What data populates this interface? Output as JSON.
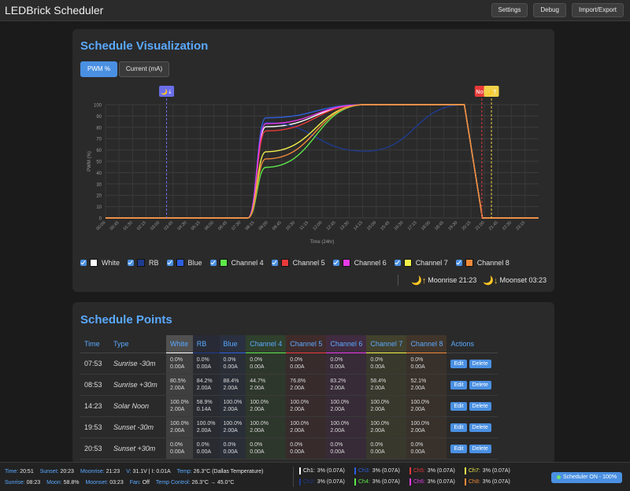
{
  "app": {
    "title": "LEDBrick Scheduler"
  },
  "top_buttons": [
    "Settings",
    "Debug",
    "Import/Export"
  ],
  "visualization": {
    "title": "Schedule Visualization",
    "toggle_pwm": "PWM %",
    "toggle_current": "Current (mA)",
    "active_toggle": "PWM %"
  },
  "chart_data": {
    "type": "line",
    "xlabel": "Time (24hr)",
    "ylabel": "PWM (%)",
    "ylim": [
      0,
      100
    ],
    "yticks": [
      0,
      10,
      20,
      30,
      40,
      50,
      60,
      70,
      80,
      90,
      100
    ],
    "xticks": [
      "00:00",
      "00:45",
      "01:30",
      "02:15",
      "03:00",
      "03:45",
      "04:30",
      "05:15",
      "06:00",
      "06:45",
      "07:30",
      "08:15",
      "09:00",
      "09:45",
      "10:30",
      "11:15",
      "12:00",
      "12:45",
      "13:30",
      "14:15",
      "15:00",
      "15:45",
      "16:30",
      "17:15",
      "18:00",
      "18:45",
      "19:30",
      "20:15",
      "21:00",
      "21:45",
      "22:30",
      "23:15"
    ],
    "grid": true,
    "series": [
      {
        "name": "White",
        "color": "#ffffff",
        "x": [
          "00:00",
          "07:53",
          "08:53",
          "14:23",
          "19:53",
          "20:53",
          "23:59"
        ],
        "values": [
          0,
          0,
          80.5,
          100,
          100,
          0,
          0
        ]
      },
      {
        "name": "RB",
        "color": "#1f3b8f",
        "x": [
          "00:00",
          "07:53",
          "08:53",
          "14:23",
          "19:53",
          "20:53",
          "23:59"
        ],
        "values": [
          0,
          0,
          84.2,
          58.9,
          100,
          0,
          0
        ]
      },
      {
        "name": "Blue",
        "color": "#2f5fe0",
        "x": [
          "00:00",
          "07:53",
          "08:53",
          "14:23",
          "19:53",
          "20:53",
          "23:59"
        ],
        "values": [
          0,
          0,
          88.4,
          100,
          100,
          0,
          0
        ]
      },
      {
        "name": "Channel 4",
        "color": "#5ee84a",
        "x": [
          "00:00",
          "07:53",
          "08:53",
          "14:23",
          "19:53",
          "20:53",
          "23:59"
        ],
        "values": [
          0,
          0,
          44.7,
          100,
          100,
          0,
          0
        ]
      },
      {
        "name": "Channel 5",
        "color": "#e83a3a",
        "x": [
          "00:00",
          "07:53",
          "08:53",
          "14:23",
          "19:53",
          "20:53",
          "23:59"
        ],
        "values": [
          0,
          0,
          76.8,
          100,
          100,
          0,
          0
        ]
      },
      {
        "name": "Channel 6",
        "color": "#e73ae8",
        "x": [
          "00:00",
          "07:53",
          "08:53",
          "14:23",
          "19:53",
          "20:53",
          "23:59"
        ],
        "values": [
          0,
          0,
          83.2,
          100,
          100,
          0,
          0
        ]
      },
      {
        "name": "Channel 7",
        "color": "#f2ef4a",
        "x": [
          "00:00",
          "07:53",
          "08:53",
          "14:23",
          "19:53",
          "20:53",
          "23:59"
        ],
        "values": [
          0,
          0,
          58.4,
          100,
          100,
          0,
          0
        ]
      },
      {
        "name": "Channel 8",
        "color": "#f08a3a",
        "x": [
          "00:00",
          "07:53",
          "08:53",
          "14:23",
          "19:53",
          "20:53",
          "23:59"
        ],
        "values": [
          0,
          0,
          52.1,
          100,
          100,
          0,
          0
        ]
      }
    ],
    "markers": [
      {
        "time": "03:23",
        "color": "#6b6ee8",
        "badge": "🌙↓"
      },
      {
        "time": "20:51",
        "color": "#e83a3a",
        "badge": "Now"
      },
      {
        "time": "21:23",
        "color": "#f2d24a",
        "badge": "🌙↑"
      }
    ]
  },
  "moon": {
    "moonrise": "Moonrise 21:23",
    "moonset": "Moonset 03:23"
  },
  "schedule": {
    "title": "Schedule Points",
    "headers": {
      "time": "Time",
      "type": "Type",
      "actions": "Actions"
    },
    "channels": [
      "White",
      "RB",
      "Blue",
      "Channel 4",
      "Channel 5",
      "Channel 6",
      "Channel 7",
      "Channel 8"
    ],
    "channel_colors": [
      "#ffffff",
      "#1f3b8f",
      "#2f5fe0",
      "#5ee84a",
      "#e83a3a",
      "#e73ae8",
      "#f2ef4a",
      "#f08a3a"
    ],
    "edit_label": "Edit",
    "delete_label": "Delete",
    "rows": [
      {
        "time": "07:53",
        "type": "Sunrise -30m",
        "values": [
          [
            "0.0%",
            "0.00A"
          ],
          [
            "0.0%",
            "0.00A"
          ],
          [
            "0.0%",
            "0.00A"
          ],
          [
            "0.0%",
            "0.00A"
          ],
          [
            "0.0%",
            "0.00A"
          ],
          [
            "0.0%",
            "0.00A"
          ],
          [
            "0.0%",
            "0.00A"
          ],
          [
            "0.0%",
            "0.00A"
          ]
        ]
      },
      {
        "time": "08:53",
        "type": "Sunrise +30m",
        "values": [
          [
            "80.5%",
            "2.00A"
          ],
          [
            "84.2%",
            "2.00A"
          ],
          [
            "88.4%",
            "2.00A"
          ],
          [
            "44.7%",
            "2.00A"
          ],
          [
            "76.8%",
            "2.00A"
          ],
          [
            "83.2%",
            "2.00A"
          ],
          [
            "58.4%",
            "2.00A"
          ],
          [
            "52.1%",
            "2.00A"
          ]
        ]
      },
      {
        "time": "14:23",
        "type": "Solar Noon",
        "values": [
          [
            "100.0%",
            "2.00A"
          ],
          [
            "58.9%",
            "0.14A"
          ],
          [
            "100.0%",
            "2.00A"
          ],
          [
            "100.0%",
            "2.00A"
          ],
          [
            "100.0%",
            "2.00A"
          ],
          [
            "100.0%",
            "2.00A"
          ],
          [
            "100.0%",
            "2.00A"
          ],
          [
            "100.0%",
            "2.00A"
          ]
        ]
      },
      {
        "time": "19:53",
        "type": "Sunset -30m",
        "values": [
          [
            "100.0%",
            "2.00A"
          ],
          [
            "100.0%",
            "2.00A"
          ],
          [
            "100.0%",
            "2.00A"
          ],
          [
            "100.0%",
            "2.00A"
          ],
          [
            "100.0%",
            "2.00A"
          ],
          [
            "100.0%",
            "2.00A"
          ],
          [
            "100.0%",
            "2.00A"
          ],
          [
            "100.0%",
            "2.00A"
          ]
        ]
      },
      {
        "time": "20:53",
        "type": "Sunset +30m",
        "values": [
          [
            "0.0%",
            "0.00A"
          ],
          [
            "0.0%",
            "0.00A"
          ],
          [
            "0.0%",
            "0.00A"
          ],
          [
            "0.0%",
            "0.00A"
          ],
          [
            "0.0%",
            "0.00A"
          ],
          [
            "0.0%",
            "0.00A"
          ],
          [
            "0.0%",
            "0.00A"
          ],
          [
            "0.0%",
            "0.00A"
          ]
        ]
      }
    ]
  },
  "status": {
    "row1": [
      {
        "key": "Time:",
        "val": "20:51"
      },
      {
        "key": "Sunset:",
        "val": "20:23"
      },
      {
        "key": "Moonrise:",
        "val": "21:23"
      },
      {
        "key": "V:",
        "val": "31.1V | I: 0.01A"
      },
      {
        "key": "Temp:",
        "val": "26.3°C (Dallas Temperature)"
      }
    ],
    "row2": [
      {
        "key": "Sunrise:",
        "val": "08:23"
      },
      {
        "key": "Moon:",
        "val": "58.8%"
      },
      {
        "key": "Moonset:",
        "val": "03:23"
      },
      {
        "key": "Fan:",
        "val": "Off"
      },
      {
        "key": "Temp Control:",
        "val": "26.3°C → 45.0°C"
      }
    ],
    "channels": [
      {
        "label": "Ch1:",
        "val": "3% (0.07A)",
        "color": "#ffffff"
      },
      {
        "label": "Ch3:",
        "val": "3% (0.07A)",
        "color": "#2f5fe0"
      },
      {
        "label": "Ch5:",
        "val": "3% (0.07A)",
        "color": "#e83a3a"
      },
      {
        "label": "Ch7:",
        "val": "3% (0.07A)",
        "color": "#f2ef4a"
      },
      {
        "label": "Ch2:",
        "val": "3% (0.07A)",
        "color": "#1f3b8f"
      },
      {
        "label": "Ch4:",
        "val": "3% (0.07A)",
        "color": "#5ee84a"
      },
      {
        "label": "Ch6:",
        "val": "3% (0.07A)",
        "color": "#e73ae8"
      },
      {
        "label": "Ch8:",
        "val": "3% (0.07A)",
        "color": "#f08a3a"
      }
    ],
    "scheduler_button": "Scheduler ON - 100%"
  }
}
